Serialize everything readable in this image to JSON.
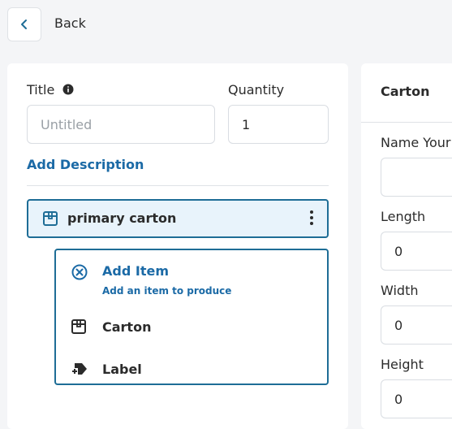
{
  "header": {
    "back_label": "Back"
  },
  "form": {
    "title_label": "Title",
    "title_placeholder": "Untitled",
    "title_value": "",
    "quantity_label": "Quantity",
    "quantity_value": "1",
    "add_description": "Add Description"
  },
  "tree": {
    "primary_label": "primary carton"
  },
  "menu": {
    "add_item_title": "Add Item",
    "add_item_sub": "Add an item to produce",
    "items": [
      {
        "label": "Carton",
        "icon": "box-icon"
      },
      {
        "label": "Label",
        "icon": "label-add-icon"
      }
    ]
  },
  "panel": {
    "title": "Carton",
    "name_label": "Name Your",
    "name_value": "",
    "length_label": "Length",
    "length_value": "0",
    "width_label": "Width",
    "width_value": "0",
    "height_label": "Height",
    "height_value": "0"
  },
  "colors": {
    "accent": "#1b6aa6",
    "selected_bg": "#e8f3fb",
    "border_accent": "#1e6d96"
  }
}
